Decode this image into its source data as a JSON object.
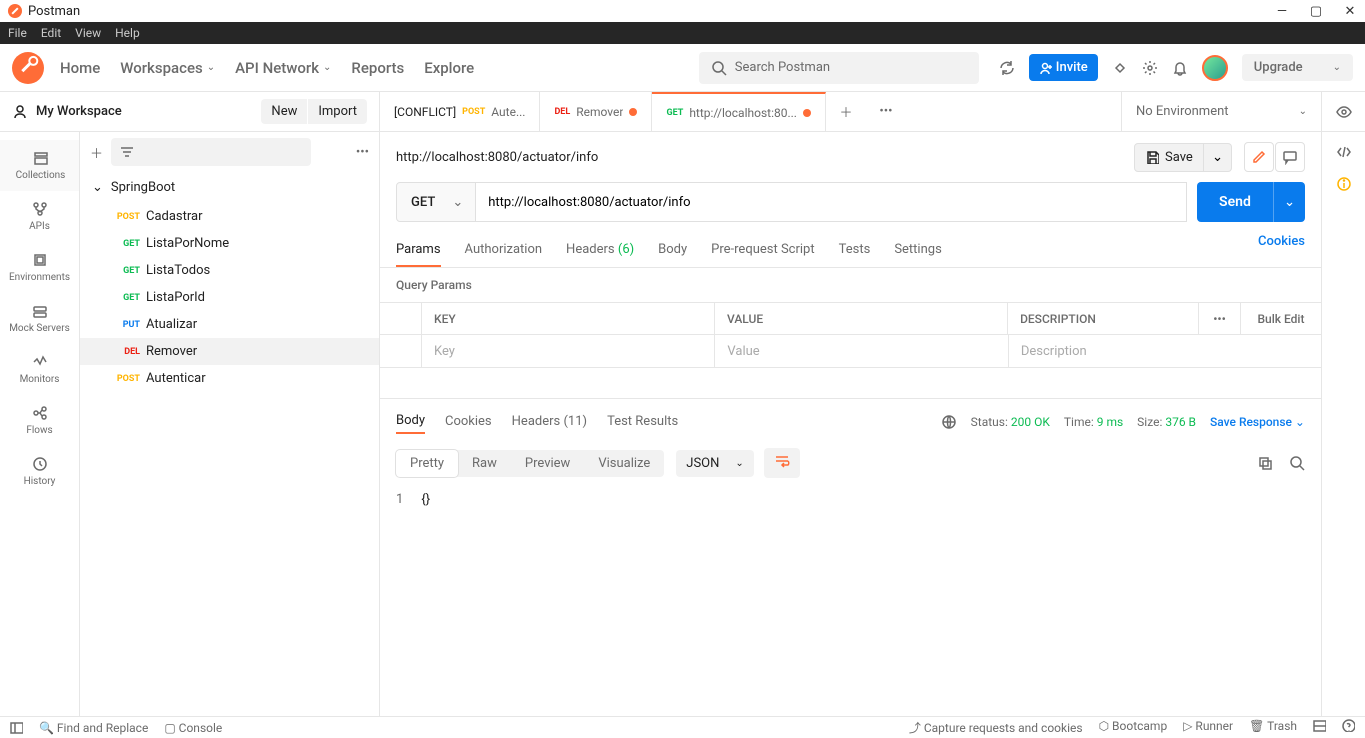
{
  "window": {
    "title": "Postman"
  },
  "menubar": [
    "File",
    "Edit",
    "View",
    "Help"
  ],
  "topnav": {
    "home": "Home",
    "workspaces": "Workspaces",
    "api_network": "API Network",
    "reports": "Reports",
    "explore": "Explore"
  },
  "search": {
    "placeholder": "Search Postman"
  },
  "invite_label": "Invite",
  "upgrade_label": "Upgrade",
  "workspace": {
    "name": "My Workspace",
    "new_btn": "New",
    "import_btn": "Import"
  },
  "tabs": [
    {
      "prefix": "[CONFLICT]",
      "method": "POST",
      "title": "Aute...",
      "unsaved": false
    },
    {
      "method": "DEL",
      "title": "Remover",
      "unsaved": true
    },
    {
      "method": "GET",
      "title": "http://localhost:80...",
      "unsaved": true,
      "active": true
    }
  ],
  "environment": {
    "selected": "No Environment"
  },
  "rail": {
    "collections": "Collections",
    "apis": "APIs",
    "environments": "Environments",
    "mock": "Mock Servers",
    "monitors": "Monitors",
    "flows": "Flows",
    "history": "History"
  },
  "tree": {
    "folder": "SpringBoot",
    "items": [
      {
        "method": "POST",
        "class": "m-post",
        "name": "Cadastrar"
      },
      {
        "method": "GET",
        "class": "m-get",
        "name": "ListaPorNome"
      },
      {
        "method": "GET",
        "class": "m-get",
        "name": "ListaTodos"
      },
      {
        "method": "GET",
        "class": "m-get",
        "name": "ListaPorId"
      },
      {
        "method": "PUT",
        "class": "m-put",
        "name": "Atualizar"
      },
      {
        "method": "DEL",
        "class": "m-del",
        "name": "Remover",
        "selected": true
      },
      {
        "method": "POST",
        "class": "m-post",
        "name": "Autenticar"
      }
    ]
  },
  "request": {
    "address": "http://localhost:8080/actuator/info",
    "save": "Save",
    "method": "GET",
    "url": "http://localhost:8080/actuator/info",
    "send": "Send",
    "tabs": {
      "params": "Params",
      "auth": "Authorization",
      "headers": "Headers",
      "headers_count": "(6)",
      "body": "Body",
      "prereq": "Pre-request Script",
      "tests": "Tests",
      "settings": "Settings",
      "cookies": "Cookies"
    },
    "query_params_title": "Query Params",
    "table": {
      "key": "KEY",
      "value": "VALUE",
      "description": "DESCRIPTION",
      "bulk": "Bulk Edit",
      "ph_key": "Key",
      "ph_value": "Value",
      "ph_desc": "Description"
    }
  },
  "response": {
    "tabs": {
      "body": "Body",
      "cookies": "Cookies",
      "headers": "Headers",
      "headers_count": "(11)",
      "tests": "Test Results"
    },
    "meta": {
      "status_label": "Status:",
      "status_value": "200 OK",
      "time_label": "Time:",
      "time_value": "9 ms",
      "size_label": "Size:",
      "size_value": "376 B",
      "save_response": "Save Response"
    },
    "view": {
      "pretty": "Pretty",
      "raw": "Raw",
      "preview": "Preview",
      "visualize": "Visualize",
      "json": "JSON"
    },
    "body_line_number": "1",
    "body_content": "{}"
  },
  "statusbar": {
    "find": "Find and Replace",
    "console": "Console",
    "capture": "Capture requests and cookies",
    "bootcamp": "Bootcamp",
    "runner": "Runner",
    "trash": "Trash"
  }
}
